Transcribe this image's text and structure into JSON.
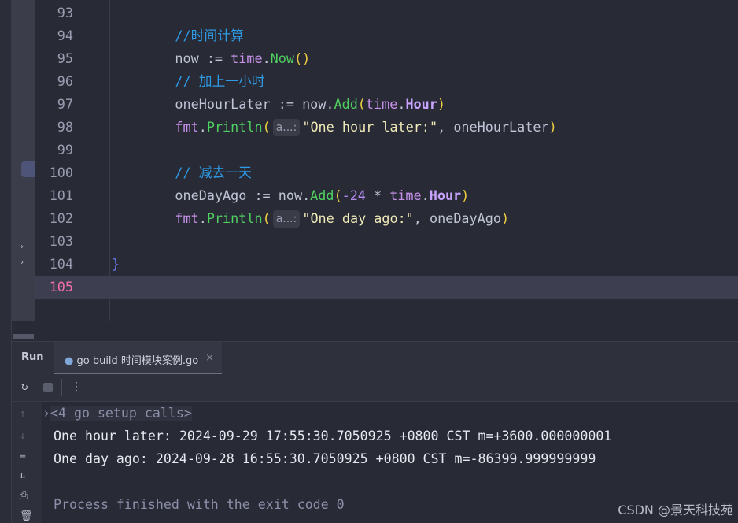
{
  "editor": {
    "lines": [
      {
        "num": "93",
        "tokens": []
      },
      {
        "num": "94",
        "tokens": [
          [
            "    ",
            ""
          ],
          [
            "//时间计算",
            "t-cm"
          ]
        ]
      },
      {
        "num": "95",
        "tokens": [
          [
            "    now := ",
            ""
          ],
          [
            "time",
            "t-pk"
          ],
          [
            ".",
            ""
          ],
          [
            "Now",
            "t-fn"
          ],
          [
            "()",
            "t-p"
          ]
        ]
      },
      {
        "num": "96",
        "tokens": [
          [
            "    ",
            ""
          ],
          [
            "// 加上一小时",
            "t-cm"
          ]
        ]
      },
      {
        "num": "97",
        "tokens": [
          [
            "    oneHourLater := now.",
            ""
          ],
          [
            "Add",
            "t-fn"
          ],
          [
            "(",
            "t-p"
          ],
          [
            "time",
            "t-pk"
          ],
          [
            ".",
            ""
          ],
          [
            "Hour",
            "t-c"
          ],
          [
            ")",
            "t-p"
          ]
        ]
      },
      {
        "num": "98",
        "tokens": [
          [
            "    ",
            ""
          ],
          [
            "fmt",
            "t-pk"
          ],
          [
            ".",
            ""
          ],
          [
            "Println",
            "t-fn"
          ],
          [
            "(",
            "t-p"
          ],
          [
            "a...:",
            "hint"
          ],
          [
            "\"One hour later:\"",
            "t-s"
          ],
          [
            ", oneHourLater",
            ""
          ],
          [
            ")",
            "t-p"
          ]
        ]
      },
      {
        "num": "99",
        "tokens": []
      },
      {
        "num": "100",
        "tokens": [
          [
            "    ",
            ""
          ],
          [
            "// 减去一天",
            "t-cm"
          ]
        ]
      },
      {
        "num": "101",
        "tokens": [
          [
            "    oneDayAgo := now.",
            ""
          ],
          [
            "Add",
            "t-fn"
          ],
          [
            "(",
            "t-p"
          ],
          [
            "-24",
            "t-n"
          ],
          [
            " * ",
            ""
          ],
          [
            "time",
            "t-pk"
          ],
          [
            ".",
            ""
          ],
          [
            "Hour",
            "t-c"
          ],
          [
            ")",
            "t-p"
          ]
        ]
      },
      {
        "num": "102",
        "tokens": [
          [
            "    ",
            ""
          ],
          [
            "fmt",
            "t-pk"
          ],
          [
            ".",
            ""
          ],
          [
            "Println",
            "t-fn"
          ],
          [
            "(",
            "t-p"
          ],
          [
            "a...:",
            "hint"
          ],
          [
            "\"One day ago:\"",
            "t-s"
          ],
          [
            ", oneDayAgo",
            ""
          ],
          [
            ")",
            "t-p"
          ]
        ]
      },
      {
        "num": "103",
        "tokens": []
      },
      {
        "num": "104",
        "tokens": [
          [
            "}",
            "t-br"
          ]
        ]
      },
      {
        "num": "105",
        "tokens": [],
        "current": true
      }
    ]
  },
  "run_panel": {
    "title": "Run",
    "tab_label": "go build 时间模块案例.go",
    "tab_close": "×",
    "setup_calls": "<4 go setup calls>",
    "output": [
      "One hour later: 2024-09-29 17:55:30.7050925 +0800 CST m=+3600.000000001",
      "One day ago: 2024-09-28 16:55:30.7050925 +0800 CST m=-86399.999999999",
      "",
      "Process finished with the exit code 0"
    ]
  },
  "watermark": "CSDN @景天科技苑"
}
